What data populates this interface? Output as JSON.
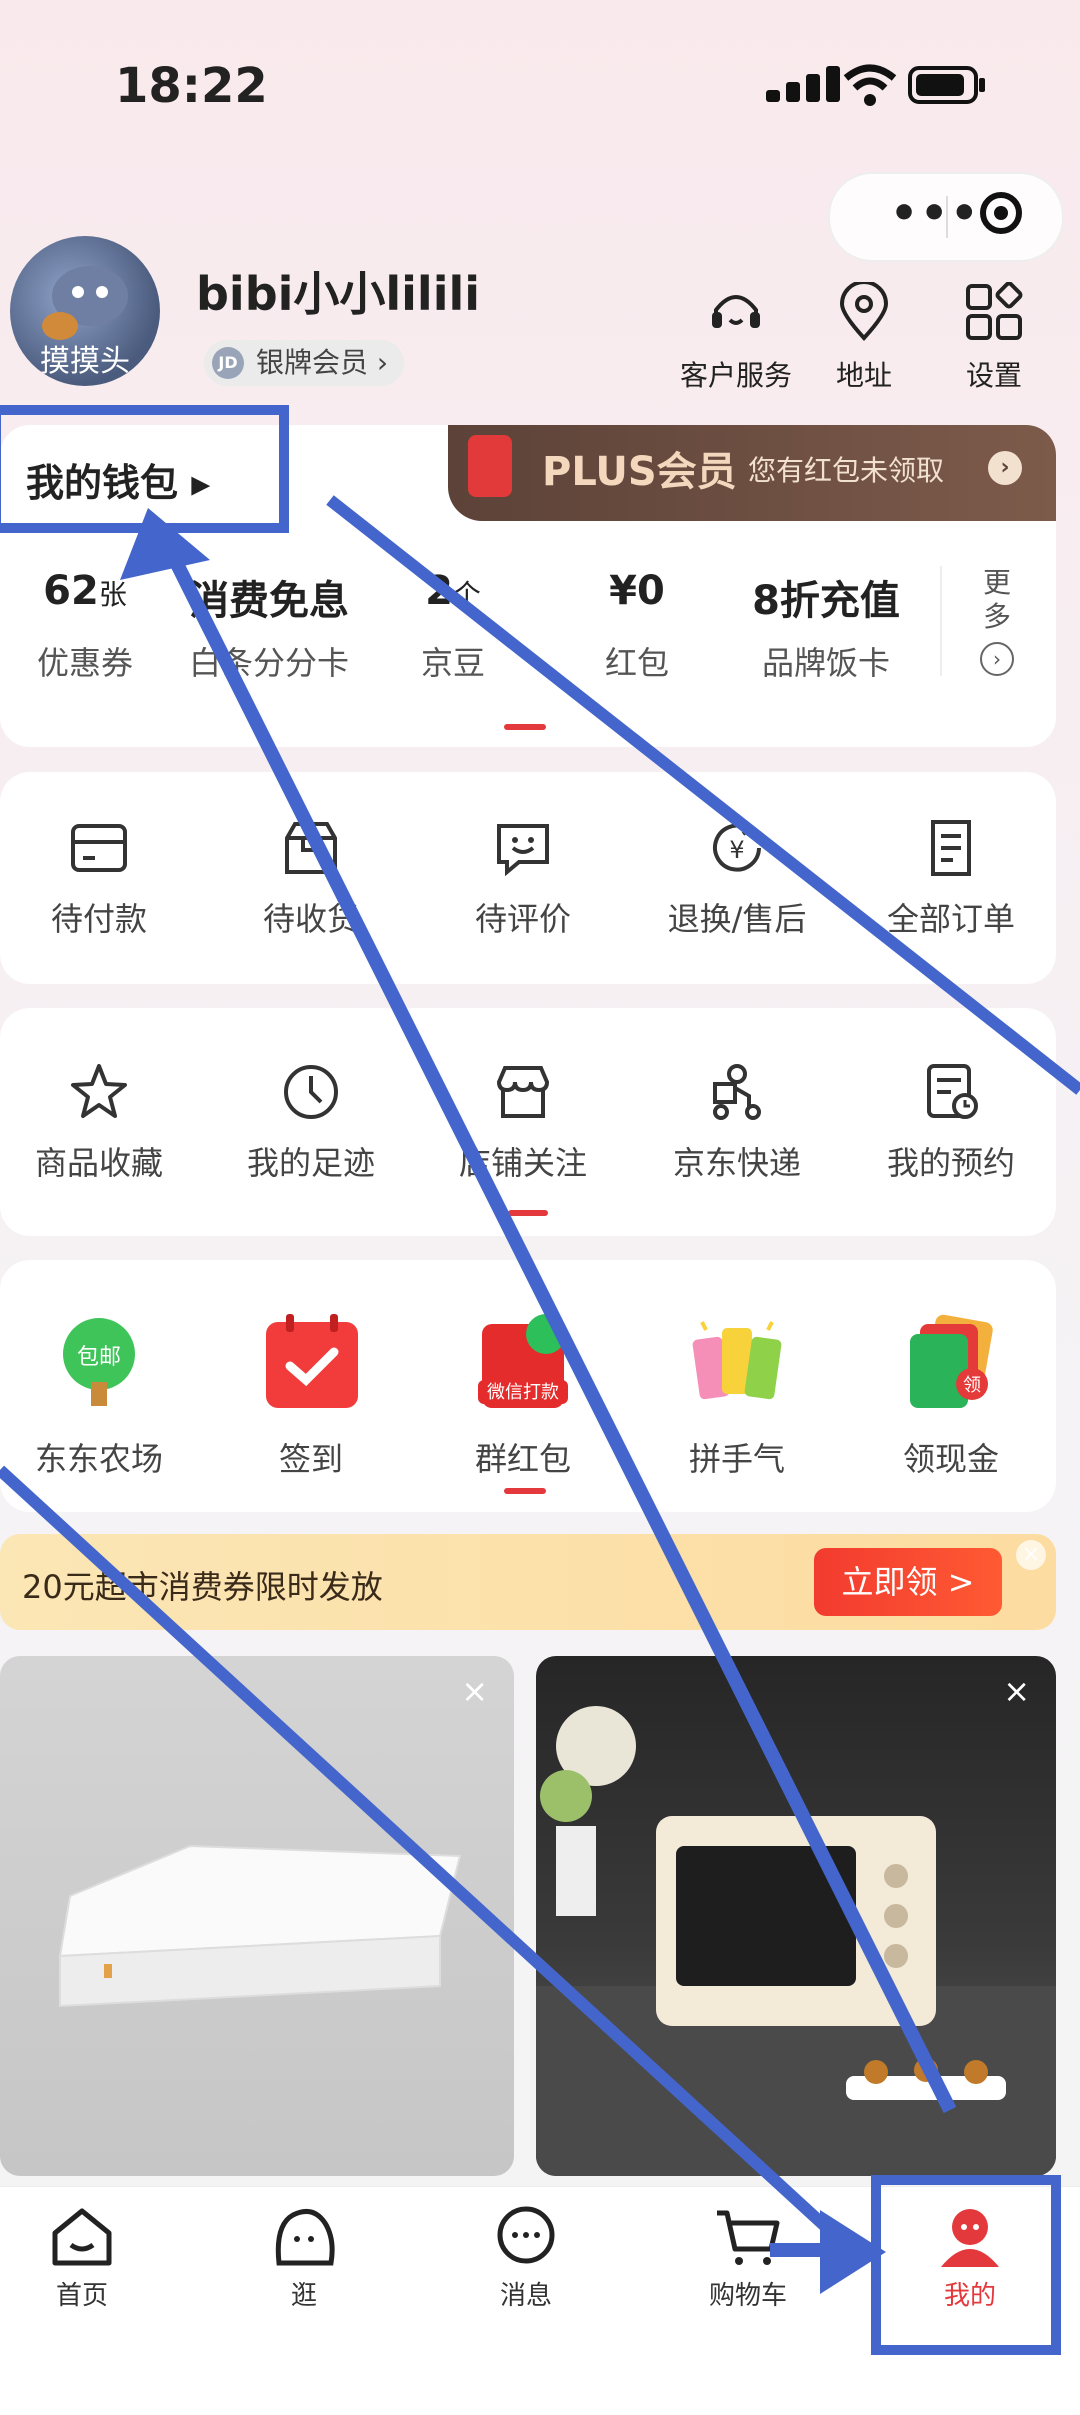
{
  "status_bar": {
    "time": "18:22"
  },
  "profile": {
    "avatar_caption": "摸摸头",
    "username": "bibi小小lilili",
    "badge": "银牌会员 ›",
    "tools": [
      {
        "label": "客户服务",
        "icon": "headset-icon"
      },
      {
        "label": "地址",
        "icon": "location-pin-icon"
      },
      {
        "label": "设置",
        "icon": "grid-settings-icon"
      }
    ]
  },
  "wallet": {
    "title": "我的钱包 ▸",
    "plus_title": "PLUS会员",
    "plus_sub": "您有红包未领取",
    "plus_arrow": "›",
    "items": [
      {
        "value": "62",
        "unit": "张",
        "label": "优惠券"
      },
      {
        "value": "消费免息",
        "unit": "",
        "label": "白条分分卡"
      },
      {
        "value": "2",
        "unit": "个",
        "label": "京豆"
      },
      {
        "value": "¥0",
        "unit": "",
        "label": "红包"
      },
      {
        "value": "8折充值",
        "unit": "",
        "label": "品牌饭卡"
      }
    ],
    "more_line1": "更",
    "more_line2": "多",
    "more_icon": "›"
  },
  "orders": [
    {
      "label": "待付款",
      "icon": "card-icon"
    },
    {
      "label": "待收货",
      "icon": "box-icon"
    },
    {
      "label": "待评价",
      "icon": "comment-smile-icon"
    },
    {
      "label": "退换/售后",
      "icon": "refund-icon"
    },
    {
      "label": "全部订单",
      "icon": "order-list-icon"
    }
  ],
  "services": [
    {
      "label": "商品收藏",
      "icon": "star-icon"
    },
    {
      "label": "我的足迹",
      "icon": "clock-icon"
    },
    {
      "label": "店铺关注",
      "icon": "shop-icon"
    },
    {
      "label": "京东快递",
      "icon": "courier-icon"
    },
    {
      "label": "我的预约",
      "icon": "reservation-icon"
    }
  ],
  "activities": [
    {
      "label": "东东农场",
      "icon": "farm-tree-icon",
      "tag": "包邮"
    },
    {
      "label": "签到",
      "icon": "calendar-check-icon"
    },
    {
      "label": "群红包",
      "icon": "red-envelope-icon",
      "tag": "微信打款"
    },
    {
      "label": "拼手气",
      "icon": "lucky-tickets-icon"
    },
    {
      "label": "领现金",
      "icon": "cash-cards-icon",
      "tag": "领"
    }
  ],
  "banner": {
    "text": "20元超市消费券限时发放",
    "button": "立即领 >",
    "close": "×"
  },
  "products": [
    {
      "name": "mattress-product",
      "close": "×"
    },
    {
      "name": "oven-product",
      "close": "×"
    }
  ],
  "tabbar": [
    {
      "label": "首页",
      "icon": "home-icon",
      "active": false
    },
    {
      "label": "逛",
      "icon": "explore-icon",
      "active": false
    },
    {
      "label": "消息",
      "icon": "message-icon",
      "active": false
    },
    {
      "label": "购物车",
      "icon": "cart-icon",
      "active": false
    },
    {
      "label": "我的",
      "icon": "profile-icon",
      "active": true
    }
  ],
  "colors": {
    "accent": "#e4393c",
    "annotation": "#4466cc",
    "plus_bg": "#5c4238"
  }
}
